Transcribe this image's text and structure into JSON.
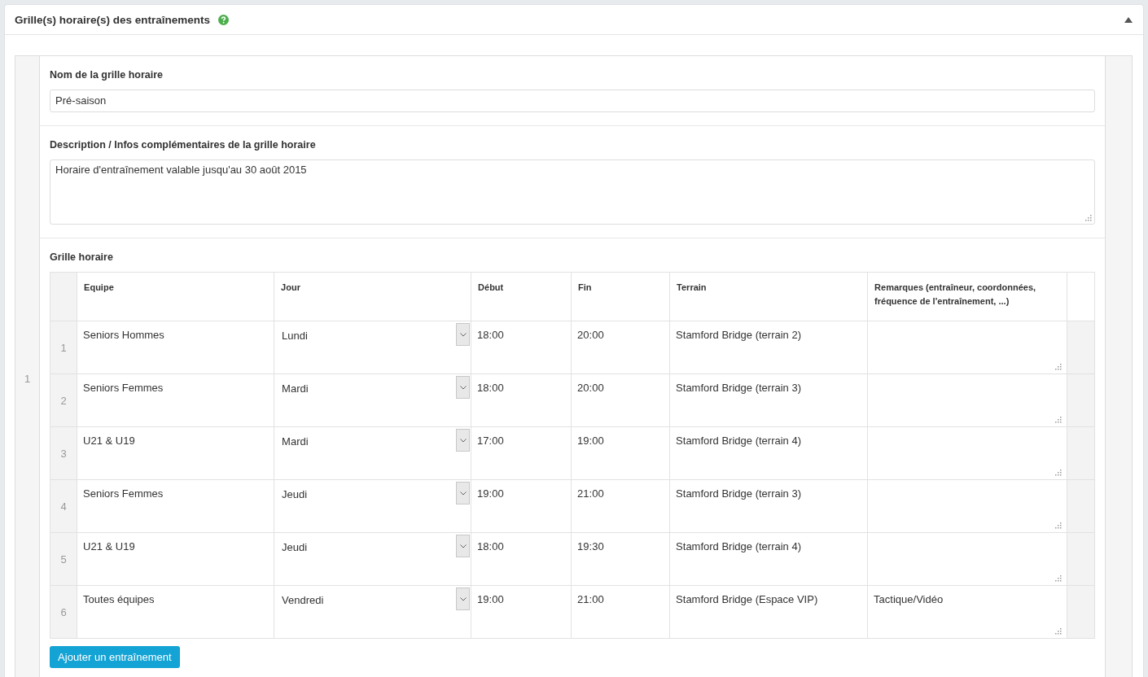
{
  "panel": {
    "title": "Grille(s) horaire(s) des entraînements",
    "expanded": true
  },
  "schedules": [
    {
      "index": "1",
      "name_field": {
        "label": "Nom de la grille horaire",
        "value": "Pré-saison"
      },
      "description_field": {
        "label": "Description / Infos complémentaires de la grille horaire",
        "value": "Horaire d'entraînement valable jusqu'au 30 août 2015"
      },
      "grid": {
        "label": "Grille horaire",
        "columns": [
          "Equipe",
          "Jour",
          "Début",
          "Fin",
          "Terrain",
          "Remarques (entraîneur, coordonnées, fréquence de l'entraînement, ...)"
        ],
        "rows": [
          {
            "index": "1",
            "team": "Seniors Hommes",
            "day": "Lundi",
            "start": "18:00",
            "end": "20:00",
            "field": "Stamford Bridge (terrain 2)",
            "remarks": ""
          },
          {
            "index": "2",
            "team": "Seniors Femmes",
            "day": "Mardi",
            "start": "18:00",
            "end": "20:00",
            "field": "Stamford Bridge (terrain 3)",
            "remarks": ""
          },
          {
            "index": "3",
            "team": "U21 & U19",
            "day": "Mardi",
            "start": "17:00",
            "end": "19:00",
            "field": "Stamford Bridge (terrain 4)",
            "remarks": ""
          },
          {
            "index": "4",
            "team": "Seniors Femmes",
            "day": "Jeudi",
            "start": "19:00",
            "end": "21:00",
            "field": "Stamford Bridge (terrain 3)",
            "remarks": ""
          },
          {
            "index": "5",
            "team": "U21 & U19",
            "day": "Jeudi",
            "start": "18:00",
            "end": "19:30",
            "field": "Stamford Bridge (terrain 4)",
            "remarks": ""
          },
          {
            "index": "6",
            "team": "Toutes équipes",
            "day": "Vendredi",
            "start": "19:00",
            "end": "21:00",
            "field": "Stamford Bridge (Espace VIP)",
            "remarks": "Tactique/Vidéo"
          }
        ]
      },
      "add_button": "Ajouter un entraînement"
    }
  ]
}
